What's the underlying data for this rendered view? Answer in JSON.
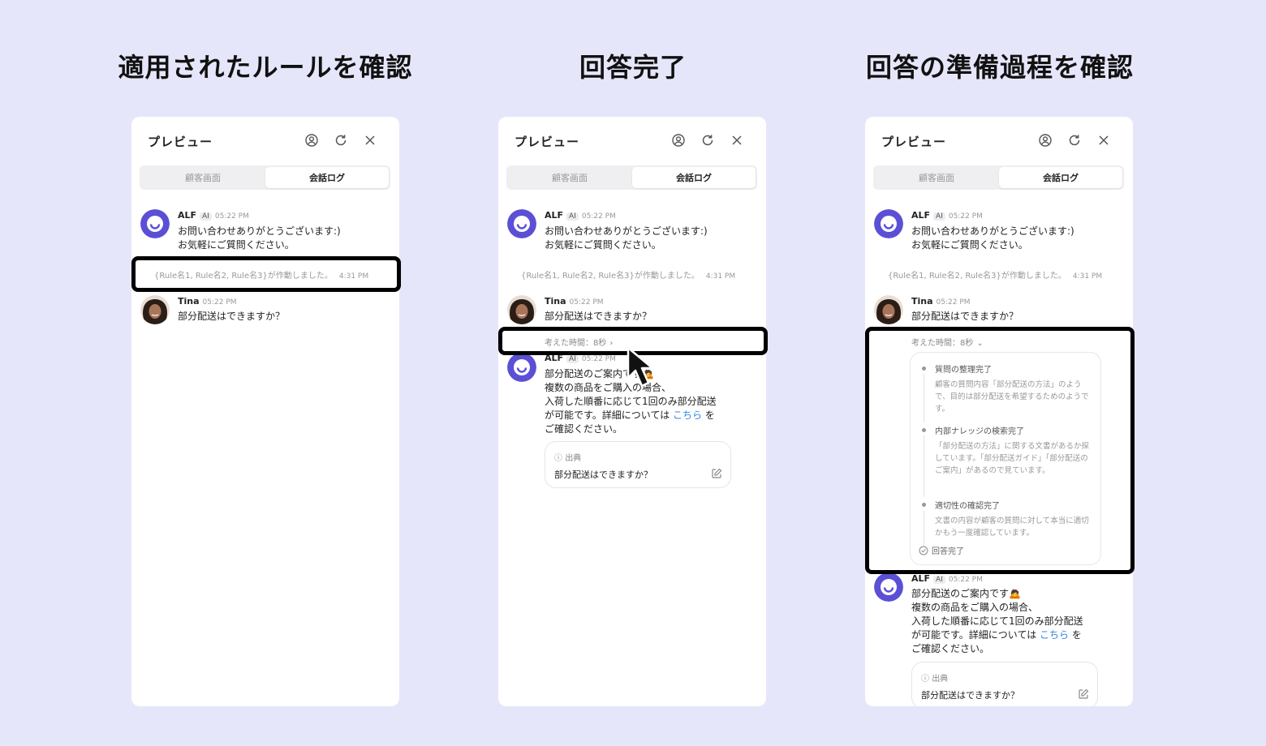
{
  "titles": [
    "適用されたルールを確認",
    "回答完了",
    "回答の準備過程を確認"
  ],
  "panel": {
    "header": "プレビュー",
    "tab_customer": "顧客画面",
    "tab_log": "会話ログ"
  },
  "alf": {
    "name": "ALF",
    "badge": "AI",
    "time": "05:22 PM",
    "greeting_line1": "お問い合わせありがとうございます:)",
    "greeting_line2": "お気軽にご質問ください。"
  },
  "rules": {
    "text": "{Rule名1, Rule名2, Rule名3}が作動しました。",
    "time": "4:31 PM"
  },
  "user": {
    "name": "Tina",
    "time": "05:22 PM",
    "message": "部分配送はできますか？"
  },
  "thinking": {
    "label": "考えた時間：8秒"
  },
  "answer": {
    "line1": "部分配送のご案内です🙇",
    "line2": "複数の商品をご購入の場合、",
    "line3": "入荷した順番に応じて1回のみ部分配送",
    "line4_pre": "が可能です。詳細については ",
    "line4_link": "こちら",
    "line4_post": " を",
    "line5": "ご確認ください。"
  },
  "source": {
    "label": "出典",
    "text": "部分配送はできますか？"
  },
  "steps": [
    {
      "title": "質問の整理完了",
      "desc": "顧客の質問内容「部分配送の方法」のようで、目的は部分配送を希望するためのようです。"
    },
    {
      "title": "内部ナレッジの検索完了",
      "desc": "「部分配送の方法」に関する文書があるか探しています。「部分配送ガイド」「部分配送のご案内」があるので見ています。"
    },
    {
      "title": "適切性の確認完了",
      "desc": "文書の内容が顧客の質問に対して本当に適切かもう一度確認しています。"
    }
  ],
  "done_label": "回答完了",
  "colors": {
    "background": "#e6e6fb",
    "alf_avatar": "#5b4fd6",
    "link": "#2f86e6",
    "highlight": "#000000"
  },
  "icons": [
    "user-circle-icon",
    "refresh-icon",
    "close-icon",
    "chevron-right-icon",
    "chevron-down-icon",
    "info-icon",
    "edit-icon",
    "check-circle-icon",
    "cursor-arrow-icon"
  ]
}
